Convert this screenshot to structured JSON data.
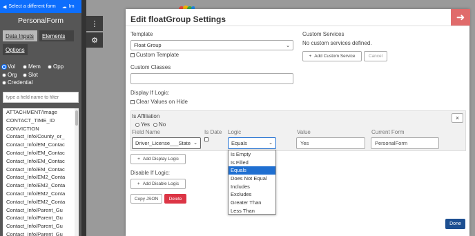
{
  "sidebar": {
    "select_form_label": "Select a different form",
    "upload_label": "Im",
    "form_title": "PersonalForm",
    "tabs": [
      "Data Inputs",
      "Elements",
      "Options"
    ],
    "radio_options": [
      {
        "label": "Vol",
        "checked": true
      },
      {
        "label": "Mem",
        "checked": false
      },
      {
        "label": "Opp",
        "checked": false
      },
      {
        "label": "Org",
        "checked": false
      },
      {
        "label": "Slot",
        "checked": false
      },
      {
        "label": "Credential",
        "checked": false
      }
    ],
    "filter_placeholder": "type a field name to filter",
    "fields": [
      "ATTACHMENT/Image",
      "CONTACT_TIME_ID",
      "CONVICTION",
      "Contact_Info/County_or_",
      "Contact_Info/EM_Contac",
      "Contact_Info/EM_Contac",
      "Contact_Info/EM_Contac",
      "Contact_Info/EM_Contac",
      "Contact_Info/EM2_Conta",
      "Contact_Info/EM2_Conta",
      "Contact_Info/EM2_Conta",
      "Contact_Info/EM2_Conta",
      "Contact_Info/Parent_Gu",
      "Contact_Info/Parent_Gu",
      "Contact_Info/Parent_Gu",
      "Contact_Info/Parent_Gu"
    ]
  },
  "side_buttons": {
    "menu_icon": "vertical-dots-icon",
    "settings_icon": "gear-icon"
  },
  "modal": {
    "title": "Edit floatGroup Settings",
    "close_icon": "arrow-right-icon",
    "template_label": "Template",
    "template_value": "Float Group",
    "custom_template_label": "Custom Template",
    "custom_services_label": "Custom Services",
    "custom_services_text": "No custom services defined.",
    "add_custom_service_label": "Add Custom Service",
    "cancel_label": "Cancel",
    "custom_classes_label": "Custom Classes",
    "custom_classes_value": "",
    "display_if_label": "Display If Logic:",
    "clear_values_label": "Clear Values on Hide",
    "logic": {
      "title": "Is Affiliation",
      "yes_label": "Yes",
      "no_label": "No",
      "field_name_header": "Field Name",
      "is_date_header": "Is Date",
      "logic_header": "Logic",
      "value_header": "Value",
      "current_form_header": "Current Form",
      "field_name_value": "Driver_License___State",
      "logic_value": "Equals",
      "value_value": "Yes",
      "current_form_value": "PersonalForm",
      "remove_label": "×"
    },
    "logic_options": [
      "Is Empty",
      "Is Filled",
      "Equals",
      "Does Not Equal",
      "Includes",
      "Excludes",
      "Greater Than",
      "Less Than"
    ],
    "logic_selected_index": 2,
    "add_display_logic_label": "Add Display Logic",
    "disable_if_label": "Disable If Logic:",
    "add_disable_logic_label": "Add Disable Logic",
    "copy_json_label": "Copy JSON",
    "delete_label": "Delete",
    "done_label": "Done"
  },
  "colors": {
    "primary": "#0d6efd",
    "danger": "#dc3545",
    "close": "#e06b6b",
    "done": "#1d4f91",
    "selected_option": "#1f6fd1"
  }
}
